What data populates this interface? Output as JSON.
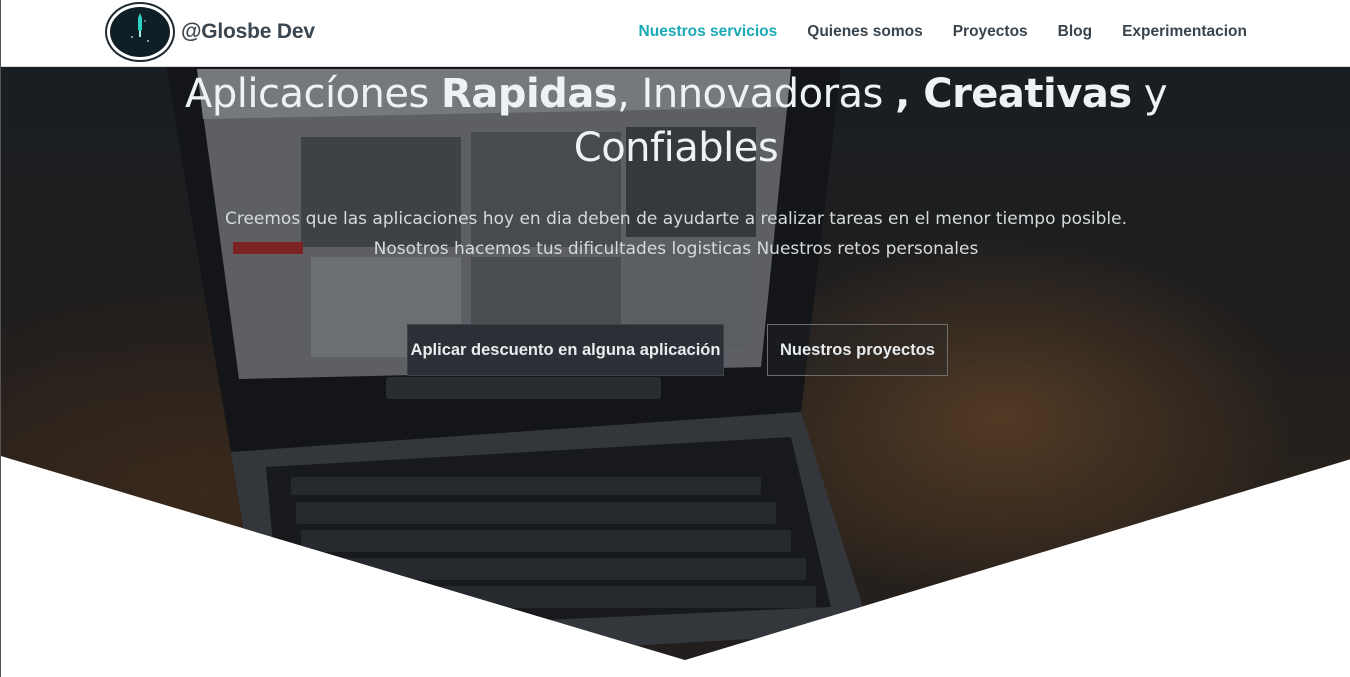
{
  "brand": {
    "name": "@Glosbe Dev",
    "logo_icon": "rocket-logo-icon"
  },
  "nav": {
    "items": [
      {
        "label": "Nuestros servicios",
        "active": true
      },
      {
        "label": "Quienes somos",
        "active": false
      },
      {
        "label": "Proyectos",
        "active": false
      },
      {
        "label": "Blog",
        "active": false
      },
      {
        "label": "Experimentacion",
        "active": false
      }
    ],
    "active_color": "#1aaab5"
  },
  "hero": {
    "headline": {
      "part1": "Aplicacíones ",
      "bold1": "Rapidas",
      "part2": ", Innovadoras ",
      "bold2": ", Creativas",
      "part3": " y Confiables"
    },
    "subtitle_line1": "Creemos que las aplicaciones hoy en dia deben de ayudarte a realizar tareas en el menor tiempo posible.",
    "subtitle_line2": "Nosotros hacemos tus dificultades logisticas Nuestros retos personales",
    "primary_button": "Aplicar descuento en alguna aplicación",
    "secondary_button": "Nuestros proyectos",
    "background_image": "laptop-on-desk-photo"
  }
}
